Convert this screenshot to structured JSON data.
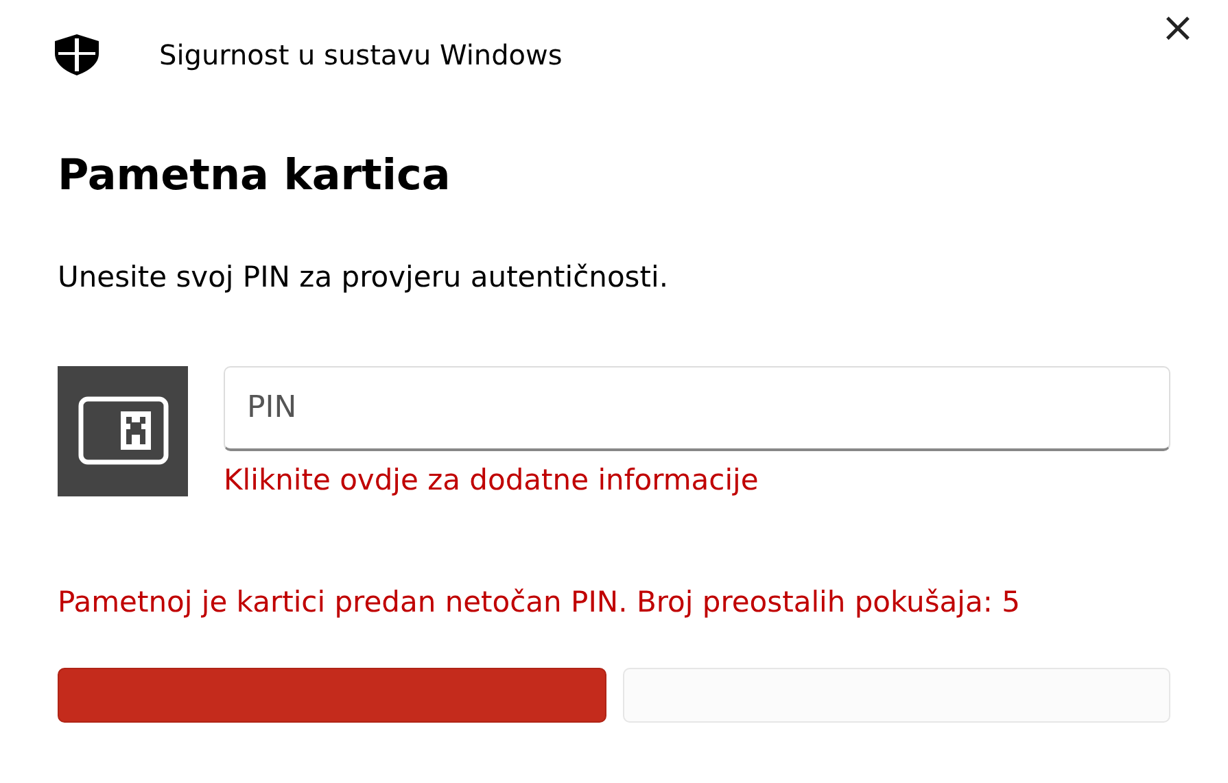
{
  "window": {
    "title": "Sigurnost u sustavu Windows",
    "close": "×"
  },
  "heading": "Pametna kartica",
  "instruction": "Unesite svoj PIN za provjeru autentičnosti.",
  "pin_field": {
    "placeholder": "PIN"
  },
  "more_info_link": "Kliknite ovdje za dodatne informacije",
  "error": "Pametnoj je kartici predan netočan PIN. Broj preostalih pokušaja: 5",
  "buttons": [
    {
      "kind": "primary"
    },
    {
      "kind": "secondary"
    }
  ]
}
